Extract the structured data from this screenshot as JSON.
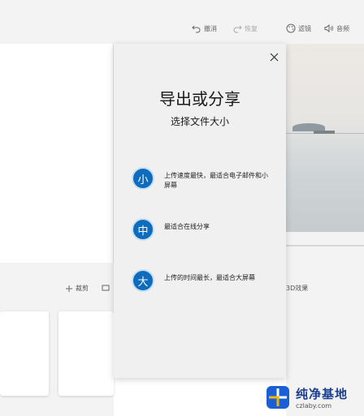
{
  "toolbar": {
    "undo_label": "撤消",
    "redo_label": "恢复",
    "filter_label": "滤镜",
    "audio_label": "音频"
  },
  "mid_tools": {
    "item1_label": "裁剪",
    "effect_label": "3D效果"
  },
  "dialog": {
    "title": "导出或分享",
    "subtitle": "选择文件大小",
    "options": [
      {
        "badge": "小",
        "text": "上传速度最快，最适合电子邮件和小屏幕"
      },
      {
        "badge": "中",
        "text": "最适合在线分享"
      },
      {
        "badge": "大",
        "text": "上传的时间最长，最适合大屏幕"
      }
    ]
  },
  "watermark": {
    "title": "纯净基地",
    "url": "czlaby.com"
  },
  "colors": {
    "accent": "#0f6cbd",
    "dialog_bg": "#f0f0f0",
    "toolbar_bg": "#f3f3f3"
  }
}
